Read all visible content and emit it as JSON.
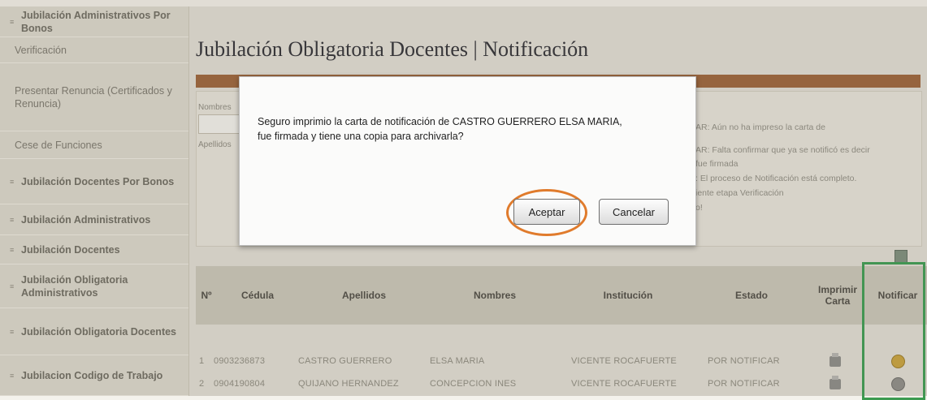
{
  "sidebar": {
    "items": [
      {
        "label": "Jubilación Administrativos Por Bonos",
        "type": "section"
      },
      {
        "label": "Verificación",
        "type": "sub"
      },
      {
        "label": "Presentar Renuncia (Certificados y Renuncia)",
        "type": "sub"
      },
      {
        "label": "Cese de Funciones",
        "type": "sub"
      },
      {
        "label": "Jubilación Docentes Por Bonos",
        "type": "section"
      },
      {
        "label": "Jubilación Administrativos",
        "type": "section"
      },
      {
        "label": "Jubilación Docentes",
        "type": "section"
      },
      {
        "label": "Jubilación Obligatoria Administrativos",
        "type": "section"
      },
      {
        "label": "Jubilación Obligatoria Docentes",
        "type": "section"
      },
      {
        "label": "Jubilacion Codigo de Trabajo",
        "type": "section"
      }
    ]
  },
  "main": {
    "title": "Jubilación Obligatoria Docentes | Notificación",
    "form": {
      "nombres_label": "Nombres",
      "apellidos_label": "Apellidos"
    },
    "legend": [
      "AR: Aún no ha impreso la carta de",
      "AR: Falta confirmar que ya se notificó es decir",
      "fue firmada",
      ": El proceso de Notificación está completo.",
      "iente etapa Verificación",
      "o!"
    ]
  },
  "table": {
    "headers": {
      "num": "Nº",
      "cedula": "Cédula",
      "apellidos": "Apellidos",
      "nombres": "Nombres",
      "institucion": "Institución",
      "estado": "Estado",
      "imprimir": "Imprimir Carta",
      "notificar": "Notificar"
    },
    "rows": [
      {
        "num": "1",
        "cedula": "0903236873",
        "apellidos": "CASTRO GUERRERO",
        "nombres": "ELSA MARIA",
        "institucion": "VICENTE ROCAFUERTE",
        "estado": "POR NOTIFICAR",
        "notify_color": "#c7a13c"
      },
      {
        "num": "2",
        "cedula": "0904190804",
        "apellidos": "QUIJANO HERNANDEZ",
        "nombres": "CONCEPCION INES",
        "institucion": "VICENTE ROCAFUERTE",
        "estado": "POR NOTIFICAR",
        "notify_color": "#8c8b86"
      }
    ]
  },
  "dialog": {
    "message_line1": "Seguro imprimio la carta de notificación de CASTRO GUERRERO ELSA MARIA,",
    "message_line2": "fue firmada y tiene una copia para archivarla?",
    "ok_label": "Aceptar",
    "cancel_label": "Cancelar"
  },
  "colors": {
    "title_bar": "#9a6238",
    "highlight_circle": "#e07b2c",
    "highlight_box": "#3c9a50"
  }
}
